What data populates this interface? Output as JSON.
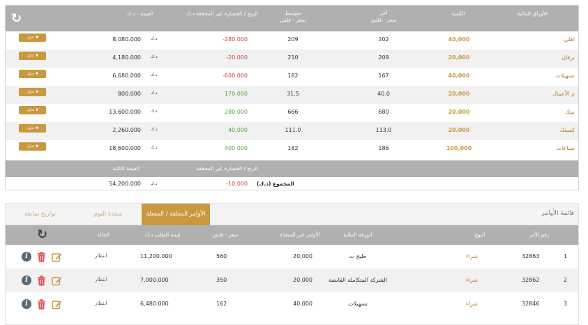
{
  "portfolio": {
    "headers": {
      "securities": "الأوراق المالية",
      "quantity": "الكمية",
      "last_line1": "آخر",
      "last_line2": "سعر - فلس",
      "avg_line1": "متوسط",
      "avg_line2": "سعر - فلس",
      "unrealized_pl": "الربح / الخسارة غير المحققة د.ك",
      "value": "القيمة - د.ك"
    },
    "trade_label": "تداول",
    "currency": "د.ك",
    "rows": [
      {
        "security": "اهلي",
        "quantity": "40,000",
        "last": "202",
        "avg": "209",
        "pl": "-280.000",
        "pl_sign": "neg",
        "value": "8,080.000"
      },
      {
        "security": "برقان",
        "quantity": "20,000",
        "last": "209",
        "avg": "210",
        "pl": "-20.000",
        "pl_sign": "neg",
        "value": "4,180.000"
      },
      {
        "security": "تسهيلات",
        "quantity": "40,000",
        "last": "167",
        "avg": "182",
        "pl": "-600.000",
        "pl_sign": "neg",
        "value": "6,680.000"
      },
      {
        "security": "م الأعمال",
        "quantity": "20,000",
        "last": "40.0",
        "avg": "31.5",
        "pl": "170.000",
        "pl_sign": "pos",
        "value": "800.000"
      },
      {
        "security": "بيتك",
        "quantity": "20,000",
        "last": "680",
        "avg": "666",
        "pl": "280.000",
        "pl_sign": "pos",
        "value": "13,600.000"
      },
      {
        "security": "كميفك",
        "quantity": "20,000",
        "last": "113.0",
        "avg": "111.0",
        "pl": "40.000",
        "pl_sign": "pos",
        "value": "2,260.000"
      },
      {
        "security": "صناعات",
        "quantity": "100,000",
        "last": "186",
        "avg": "182",
        "pl": "400.000",
        "pl_sign": "pos",
        "value": "18,600.000"
      }
    ],
    "totals": {
      "pl_header": "الربح / الخسارة غير المحققة",
      "value_header": "القيمة الكلية",
      "label": "المجموع (د.ك)",
      "pl": "-10.000",
      "currency": "د.ك",
      "value": "54,200.000"
    }
  },
  "orders": {
    "title": "قائمة الأوامر",
    "tabs": [
      {
        "label": "الأوامر المعلقة / المفعلة",
        "active": true
      },
      {
        "label": "منفذة اليوم",
        "active": false
      },
      {
        "label": "تواريخ سابقة",
        "active": false
      }
    ],
    "headers": {
      "order_no": "رقم الأمر",
      "type": "النوع",
      "security": "الورقة المالية",
      "unexecuted": "الأوامر غير المنفذة",
      "price": "سعر - فلس",
      "order_value": "قيمة الطلب د.ك",
      "status": "الحالة"
    },
    "rows": [
      {
        "idx": "1",
        "order_no": "32863",
        "type": "شراء",
        "security": "خليج ت",
        "unexecuted": "20,000",
        "price": "560",
        "order_value": "11,200.000",
        "status": "انتظار"
      },
      {
        "idx": "2",
        "order_no": "32862",
        "type": "شراء",
        "security": "الشركة المتكاملة القابضة",
        "unexecuted": "20,000",
        "price": "350",
        "order_value": "7,000.000",
        "status": "انتظار"
      },
      {
        "idx": "3",
        "order_no": "32846",
        "type": "شراء",
        "security": "تسهيلات",
        "unexecuted": "40,000",
        "price": "162",
        "order_value": "6,480.000",
        "status": "انتظار"
      }
    ]
  },
  "colors": {
    "header_gray": "#b0b0b0",
    "accent_gold": "#c9983f",
    "negative_red": "#d64541",
    "positive_green": "#58a53d",
    "info_icon": "#5a6a78",
    "trash_icon": "#d9534f"
  },
  "icons": [
    "refresh-icon",
    "info-icon",
    "trash-icon",
    "edit-icon",
    "chevron-down-icon"
  ]
}
